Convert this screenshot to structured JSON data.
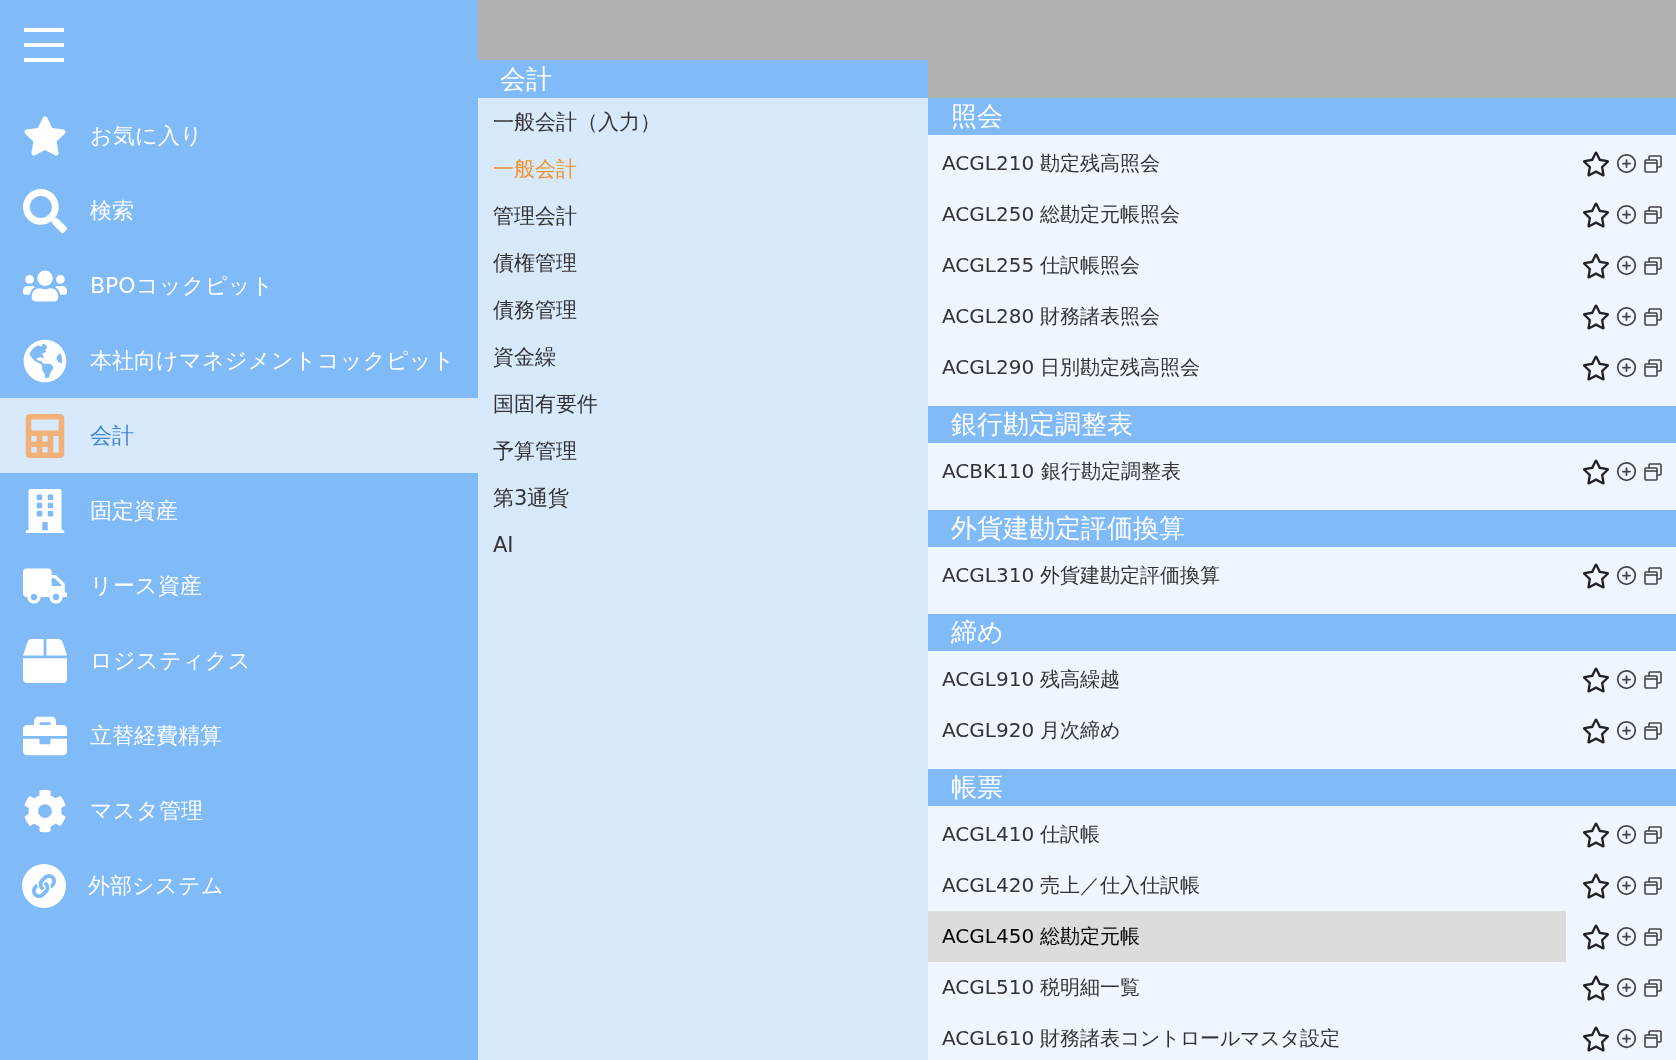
{
  "sidebar": {
    "items": [
      {
        "label": "お気に入り",
        "selected": false
      },
      {
        "label": "検索",
        "selected": false
      },
      {
        "label": "BPOコックピット",
        "selected": false
      },
      {
        "label": "本社向けマネジメントコックピット",
        "selected": false
      },
      {
        "label": "会計",
        "selected": true
      },
      {
        "label": "固定資産",
        "selected": false
      },
      {
        "label": "リース資産",
        "selected": false
      },
      {
        "label": "ロジスティクス",
        "selected": false
      },
      {
        "label": "立替経費精算",
        "selected": false
      },
      {
        "label": "マスタ管理",
        "selected": false
      },
      {
        "label": "外部システム",
        "selected": false
      }
    ]
  },
  "submenu": {
    "title": "会計",
    "items": [
      {
        "label": "一般会計（入力）",
        "selected": false
      },
      {
        "label": "一般会計",
        "selected": true
      },
      {
        "label": "管理会計",
        "selected": false
      },
      {
        "label": "債権管理",
        "selected": false
      },
      {
        "label": "債務管理",
        "selected": false
      },
      {
        "label": "資金繰",
        "selected": false
      },
      {
        "label": "国固有要件",
        "selected": false
      },
      {
        "label": "予算管理",
        "selected": false
      },
      {
        "label": "第3通貨",
        "selected": false
      },
      {
        "label": "AI",
        "selected": false
      }
    ]
  },
  "sections": [
    {
      "title": "照会",
      "rows": [
        {
          "label": "ACGL210 勘定残高照会",
          "selected": false
        },
        {
          "label": "ACGL250 総勘定元帳照会",
          "selected": false
        },
        {
          "label": "ACGL255 仕訳帳照会",
          "selected": false
        },
        {
          "label": "ACGL280 財務諸表照会",
          "selected": false
        },
        {
          "label": "ACGL290 日別勘定残高照会",
          "selected": false
        }
      ]
    },
    {
      "title": "銀行勘定調整表",
      "rows": [
        {
          "label": "ACBK110 銀行勘定調整表",
          "selected": false
        }
      ]
    },
    {
      "title": "外貨建勘定評価換算",
      "rows": [
        {
          "label": "ACGL310 外貨建勘定評価換算",
          "selected": false
        }
      ]
    },
    {
      "title": "締め",
      "rows": [
        {
          "label": "ACGL910 残高繰越",
          "selected": false
        },
        {
          "label": "ACGL920 月次締め",
          "selected": false
        }
      ]
    },
    {
      "title": "帳票",
      "rows": [
        {
          "label": "ACGL410 仕訳帳",
          "selected": false
        },
        {
          "label": "ACGL420 売上／仕入仕訳帳",
          "selected": false
        },
        {
          "label": "ACGL450 総勘定元帳",
          "selected": true
        },
        {
          "label": "ACGL510 税明細一覧",
          "selected": false
        },
        {
          "label": "ACGL610 財務諸表コントロールマスタ設定",
          "selected": false
        }
      ]
    }
  ]
}
